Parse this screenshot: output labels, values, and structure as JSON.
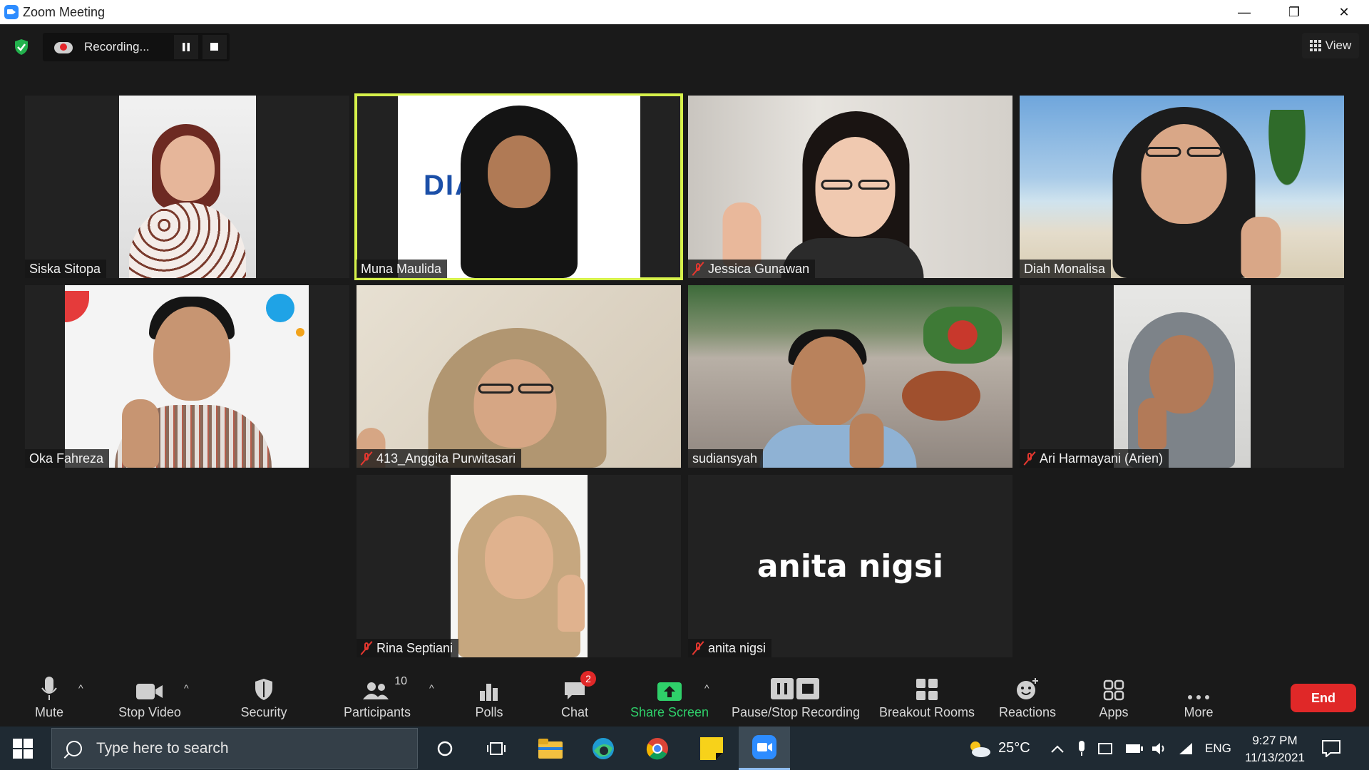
{
  "window": {
    "title": "Zoom Meeting",
    "controls": {
      "minimize": "—",
      "restore": "❐",
      "close": "✕"
    }
  },
  "topbar": {
    "recording_label": "Recording...",
    "view_label": "View"
  },
  "participants": [
    {
      "name": "Siska Sitopa",
      "muted": false
    },
    {
      "name": "Muna Maulida",
      "muted": false,
      "active_speaker": true,
      "background_text": "DIA KA"
    },
    {
      "name": "Jessica Gunawan",
      "muted": true
    },
    {
      "name": "Diah Monalisa",
      "muted": false
    },
    {
      "name": "Oka Fahreza",
      "muted": false
    },
    {
      "name": "413_Anggita Purwitasari",
      "muted": true
    },
    {
      "name": "sudiansyah",
      "muted": false
    },
    {
      "name": "Ari Harmayani (Arien)",
      "muted": true
    },
    {
      "name": "Rina Septiani",
      "muted": true
    },
    {
      "name": "anita nigsi",
      "muted": true,
      "video_off": true,
      "display_text": "anita nigsi"
    }
  ],
  "toolbar": {
    "mute": "Mute",
    "stop_video": "Stop Video",
    "security": "Security",
    "participants": "Participants",
    "participants_count": "10",
    "polls": "Polls",
    "chat": "Chat",
    "chat_badge": "2",
    "share_screen": "Share Screen",
    "pause_stop_recording": "Pause/Stop Recording",
    "breakout_rooms": "Breakout Rooms",
    "reactions": "Reactions",
    "apps": "Apps",
    "more": "More",
    "end": "End"
  },
  "taskbar": {
    "search_placeholder": "Type here to search",
    "weather": "25°C",
    "language": "ENG",
    "time": "9:27 PM",
    "date": "11/13/2021"
  },
  "colors": {
    "active_speaker_border": "#d6f14b",
    "end_button": "#e02828",
    "share_green": "#2fd06a",
    "muted_red": "#e4372f"
  }
}
